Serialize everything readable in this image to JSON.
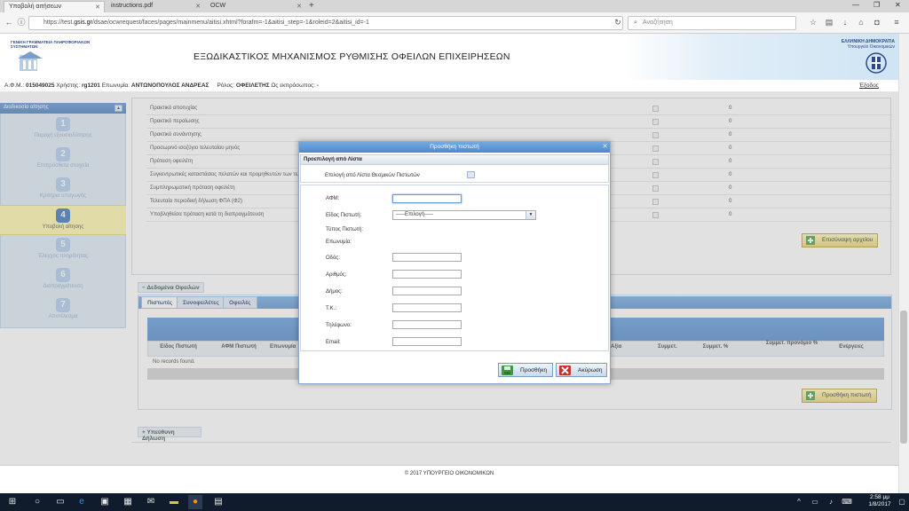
{
  "browser": {
    "tabs": [
      {
        "label": "Υποβολή αιτήσεων",
        "active": true
      },
      {
        "label": "instructions.pdf",
        "active": false
      },
      {
        "label": "OCW",
        "active": false
      }
    ],
    "url_prefix": "https://test.",
    "url_domain": "gsis.gr",
    "url_suffix": "/dsae/ocwrequest/faces/pages/mainmenu/aitisi.xhtml?forafm=-1&aitisi_step=-1&roleid=2&aitisi_id=-1",
    "search_placeholder": "Αναζήτηση"
  },
  "header": {
    "org_name": "ΓΕΝΙΚΗ ΓΡΑΜΜΑΤΕΙΑ ΠΛΗΡΟΦΟΡΙΑΚΩΝ ΣΥΣΤΗΜΑΤΩΝ",
    "title": "ΕΞΩΔΙΚΑΣΤΙΚΟΣ ΜΗΧΑΝΙΣΜΟΣ ΡΥΘΜΙΣΗΣ ΟΦΕΙΛΩΝ ΕΠΙΧΕΙΡΗΣΕΩΝ",
    "country": "ΕΛΛΗΝΙΚΗ ΔΗΜΟΚΡΑΤΙΑ",
    "ministry": "Υπουργείο Οικονομικών"
  },
  "userbar": {
    "afm_label": "Α.Φ.Μ.:",
    "afm": "015049025",
    "user_label": "Χρήστης:",
    "user": "rg1201",
    "name_label": "Επωνυμία:",
    "name": "ΑΝΤΩΝΟΠΟΥΛΟΣ ΑΝΔΡΕΑΣ",
    "role_label": "Ρόλος:",
    "role": "ΟΦΕΙΛΕΤΗΣ",
    "rep_label": "Ως εκπρόσωπος:",
    "rep": "-",
    "logout": "Έξοδος"
  },
  "sidebar": {
    "title": "Διαδικασία αίτησης",
    "steps": [
      {
        "num": "1",
        "label": "Παροχή εξουσιοδότησης"
      },
      {
        "num": "2",
        "label": "Επιπρόσθετα στοιχεία"
      },
      {
        "num": "3",
        "label": "Κριτήρια υπαγωγής"
      },
      {
        "num": "4",
        "label": "Υποβολή αίτησης"
      },
      {
        "num": "5",
        "label": "Έλεγχος πληρότητας"
      },
      {
        "num": "6",
        "label": "Διαπραγμάτευση"
      },
      {
        "num": "7",
        "label": "Αποτέλεσμα"
      }
    ],
    "active_step": "4"
  },
  "documents": {
    "rows": [
      {
        "name": "Πρακτικό αποτυχίας",
        "count": "0"
      },
      {
        "name": "Πρακτικό περαίωσης",
        "count": "0"
      },
      {
        "name": "Πρακτικό συνάντησης",
        "count": "0"
      },
      {
        "name": "Προσωρινό ισοζύγιο τελευταίου μηνός",
        "count": "0"
      },
      {
        "name": "Πρόταση οφειλέτη",
        "count": "0"
      },
      {
        "name": "Συγκεντρωτικές καταστάσεις πελατών και προμηθευτών των τελευ",
        "count": "0"
      },
      {
        "name": "Συμπληρωματική πρόταση οφειλέτη",
        "count": "0"
      },
      {
        "name": "Τελευταία περιοδική δήλωση ΦΠΑ (Φ2)",
        "count": "0"
      },
      {
        "name": "Υποβληθείσα πρόταση κατά τη διαπραγμάτευση",
        "count": "0"
      }
    ],
    "upload_button": "Επισύναψη αρχείου"
  },
  "debts": {
    "section_title": "Δεδομένα Οφειλών",
    "tabs": [
      "Πιστωτές",
      "Συνοφειλέτες",
      "Οφειλές"
    ],
    "columns": [
      "Είδος Πιστωτή",
      "ΑΦΜ Πιστωτή",
      "Επωνυμία",
      "Αξία",
      "Συμμετ.",
      "Συμμετ. %",
      "Συμμετ. προνόμιο %",
      "Ενέργειες"
    ],
    "empty_text": "No records found.",
    "add_button": "Προσθήκη πιστωτή"
  },
  "declaration": {
    "section_title": "Υπεύθυνη Δήλωση"
  },
  "footer": {
    "text": "© 2017 ΥΠΟΥΡΓΕΙΟ ΟΙΚΟΝΟΜΙΚΩΝ"
  },
  "modal": {
    "title": "Προσθήκη πιστωτή",
    "preselect_title": "Προεπιλογή από Λίστα",
    "preselect_label": "Επιλογή από Λίστα Θεσμικών Πιστωτών",
    "fields": {
      "afm": "ΑΦΜ:",
      "type": "Είδος Πιστωτή:",
      "type_value": "-----Επιλογή-----",
      "creditor_type": "Τύπος Πιστωτή:",
      "name": "Επωνυμία:",
      "street": "Οδός:",
      "number": "Αριθμός:",
      "municipality": "Δήμος:",
      "zip": "Τ.Κ.:",
      "phone": "Τηλέφωνο:",
      "email": "Email:"
    },
    "add_button": "Προσθήκη",
    "cancel_button": "Ακύρωση"
  },
  "taskbar": {
    "time": "2:58 μμ",
    "date": "1/8/2017"
  }
}
